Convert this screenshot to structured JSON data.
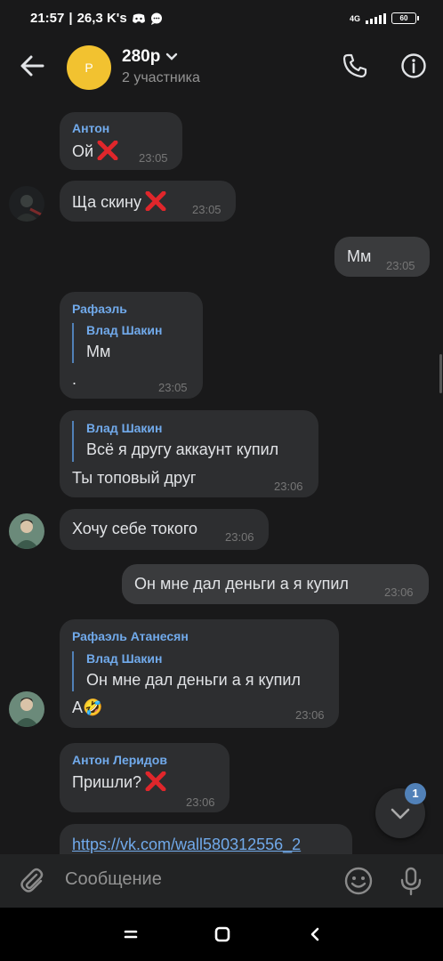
{
  "status_bar": {
    "time": "21:57",
    "speed": "26,3 K's",
    "network": "4G",
    "battery": "60"
  },
  "header": {
    "avatar_letter": "Р",
    "title": "280р",
    "subtitle": "2 участника",
    "avatar_color": "#f2c230"
  },
  "messages": [
    {
      "sender": "Антон",
      "text": "Ой",
      "time": "23:05"
    },
    {
      "text": "Ща скину",
      "time": "23:05"
    },
    {
      "text": "Мм",
      "time": "23:05",
      "outgoing": true
    },
    {
      "sender": "Рафаэль",
      "reply_name": "Влад Шакин",
      "reply_text": "Мм",
      "text": ".",
      "time": "23:05"
    },
    {
      "reply_name": "Влад Шакин",
      "reply_text": "Всё я другу аккаунт купил",
      "text": "Ты топовый друг",
      "time": "23:06"
    },
    {
      "text": "Хочу себе токого",
      "time": "23:06"
    },
    {
      "text": "Он мне дал деньги а я купил",
      "time": "23:06",
      "outgoing": true
    },
    {
      "sender": "Рафаэль Атанесян",
      "reply_name": "Влад Шакин",
      "reply_text": "Он мне дал деньги а я купил",
      "text": "А🤣",
      "time": "23:06"
    },
    {
      "sender": "Антон Леридов",
      "text": "Пришли?",
      "time": "23:06"
    },
    {
      "link": "https://vk.com/wall580312556_2"
    }
  ],
  "scroll_badge": "1",
  "composer": {
    "placeholder": "Сообщение"
  },
  "colors": {
    "accent": "#71aaeb",
    "background": "#19191a",
    "bubble": "#2d2e30",
    "badge": "#5181b8"
  }
}
